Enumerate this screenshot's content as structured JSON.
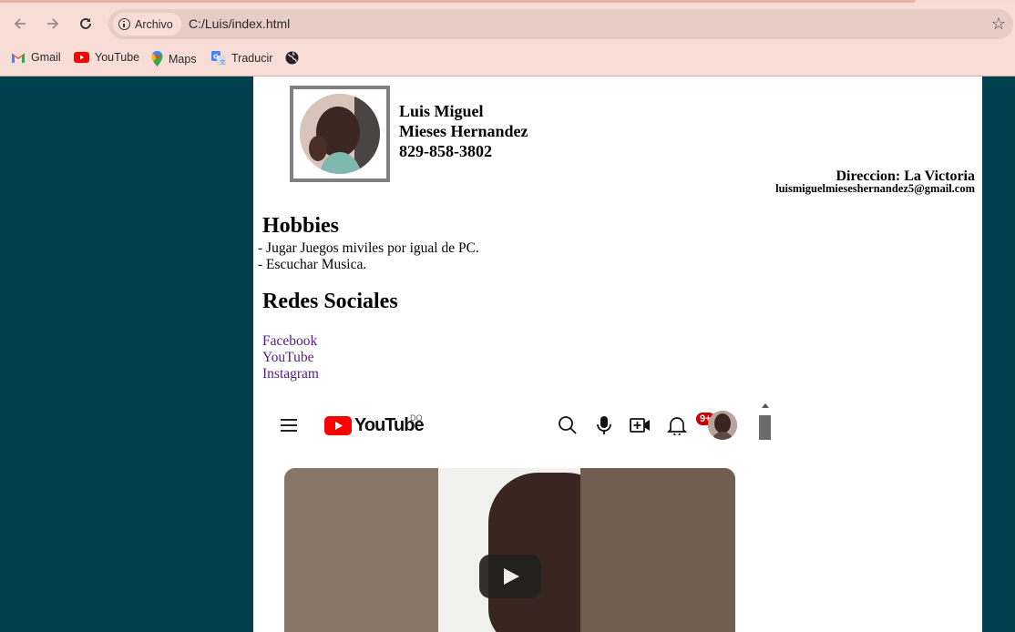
{
  "browser": {
    "site_chip_label": "Archivo",
    "url": "C:/Luis/index.html",
    "bookmarks": [
      {
        "label": "Gmail",
        "icon": "gmail-icon"
      },
      {
        "label": "YouTube",
        "icon": "youtube-icon"
      },
      {
        "label": "Maps",
        "icon": "maps-icon"
      },
      {
        "label": "Traducir",
        "icon": "translate-icon"
      },
      {
        "label": "",
        "icon": "globe-icon"
      }
    ],
    "colors": {
      "toolbar": "#f7ddd6",
      "omnibox": "#e8cdc6",
      "page_background": "#03404f"
    }
  },
  "profile": {
    "name_line1": "Luis Miguel",
    "name_line2": "Mieses Hernandez",
    "phone": "829-858-3802",
    "address": "Direccion: La Victoria",
    "email": "luismiguelmieseshernandez5@gmail.com"
  },
  "hobbies": {
    "heading": "Hobbies",
    "items": [
      "- Jugar Juegos miviles por igual de PC.",
      "- Escuchar Musica."
    ]
  },
  "social": {
    "heading": "Redes Sociales",
    "links": [
      "Facebook",
      "YouTube",
      "Instagram"
    ],
    "link_color": "#551a8b"
  },
  "youtube_embed": {
    "logo_text": "YouTube",
    "country_code": "DO",
    "notification_count": "9+",
    "brand_color": "#ff0000"
  }
}
